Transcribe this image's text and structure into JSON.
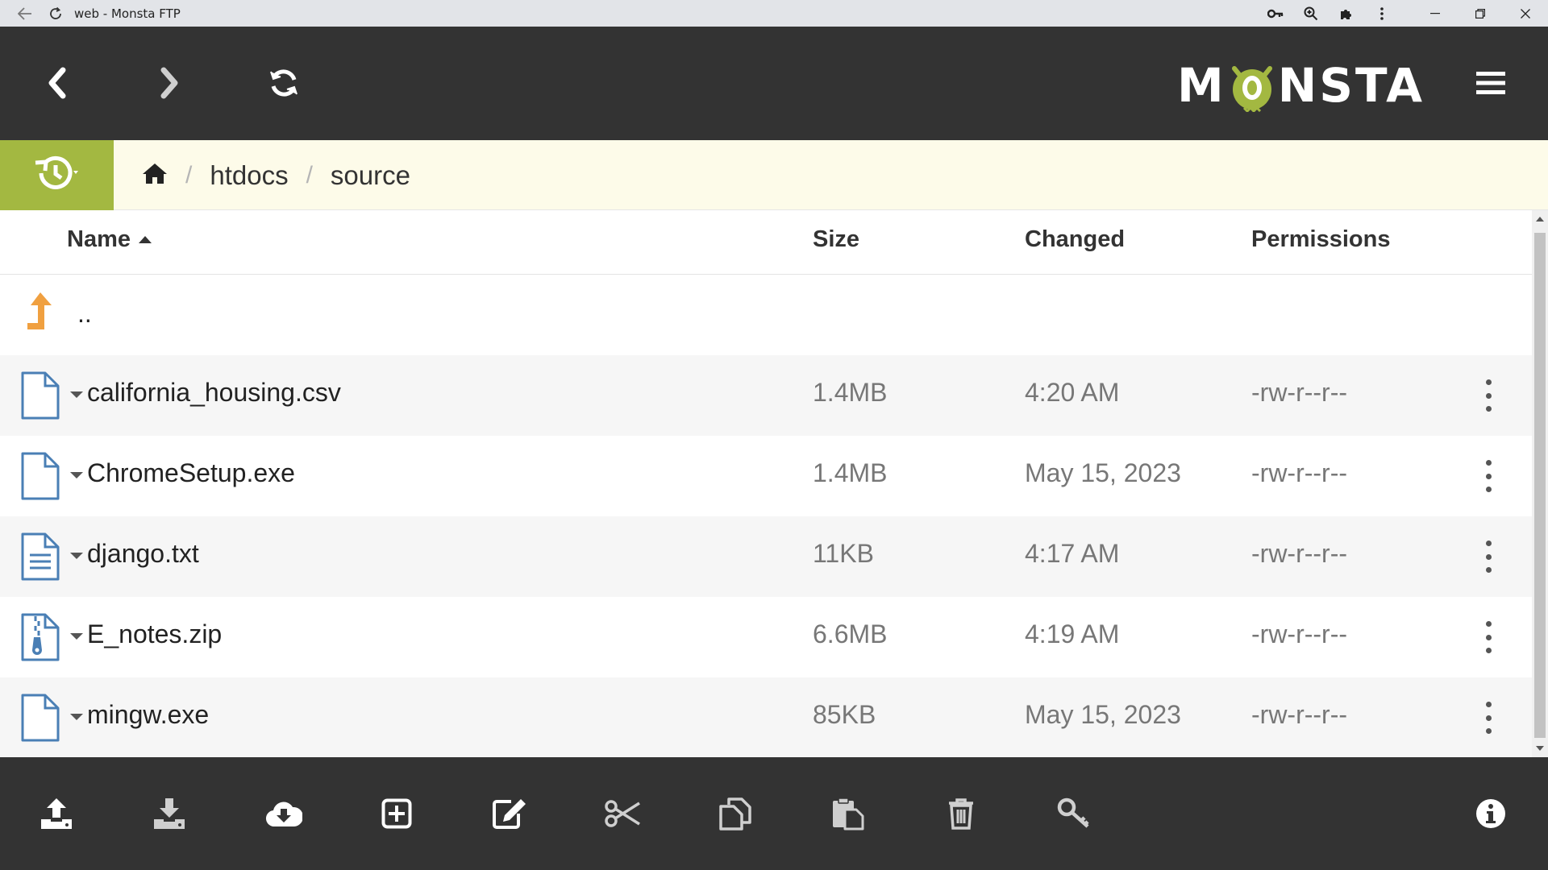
{
  "window": {
    "title": "web - Monsta FTP",
    "icons": [
      "back-arrow-icon",
      "reload-icon",
      "key-icon",
      "zoom-icon",
      "extensions-icon",
      "more-vert-icon",
      "minimize-icon",
      "restore-icon",
      "close-icon"
    ]
  },
  "header": {
    "logo_left": "M",
    "logo_right": "NSTA",
    "logo_alt": "MONSTA",
    "icons": [
      "chevron-left-icon",
      "chevron-right-icon",
      "refresh-icon",
      "hamburger-menu-icon"
    ]
  },
  "breadcrumb": {
    "home_icon": "home-icon",
    "history_icon": "history-icon",
    "items": [
      "htdocs",
      "source"
    ],
    "separator": "/"
  },
  "columns": {
    "name": "Name",
    "size": "Size",
    "changed": "Changed",
    "permissions": "Permissions",
    "sort": "ascending"
  },
  "updir": {
    "label": ".."
  },
  "files": [
    {
      "name": "california_housing.csv",
      "size": "1.4MB",
      "changed": "4:20 AM",
      "permissions": "-rw-r--r--",
      "icon": "file-icon"
    },
    {
      "name": "ChromeSetup.exe",
      "size": "1.4MB",
      "changed": "May 15, 2023",
      "permissions": "-rw-r--r--",
      "icon": "file-icon"
    },
    {
      "name": "django.txt",
      "size": "11KB",
      "changed": "4:17 AM",
      "permissions": "-rw-r--r--",
      "icon": "text-file-icon"
    },
    {
      "name": "E_notes.zip",
      "size": "6.6MB",
      "changed": "4:19 AM",
      "permissions": "-rw-r--r--",
      "icon": "zip-file-icon"
    },
    {
      "name": "mingw.exe",
      "size": "85KB",
      "changed": "May 15, 2023",
      "permissions": "-rw-r--r--",
      "icon": "file-icon"
    }
  ],
  "toolbar": {
    "icons": [
      "upload-icon",
      "download-icon",
      "cloud-download-icon",
      "new-item-icon",
      "edit-icon",
      "cut-icon",
      "copy-icon",
      "paste-icon",
      "delete-icon",
      "permissions-key-icon",
      "info-icon"
    ]
  },
  "colors": {
    "chrome_dark": "#333333",
    "accent_green": "#a3b841",
    "breadcrumb_bg": "#fdfbe9",
    "file_icon_blue": "#4a7fb5",
    "updir_orange": "#f0a040"
  }
}
